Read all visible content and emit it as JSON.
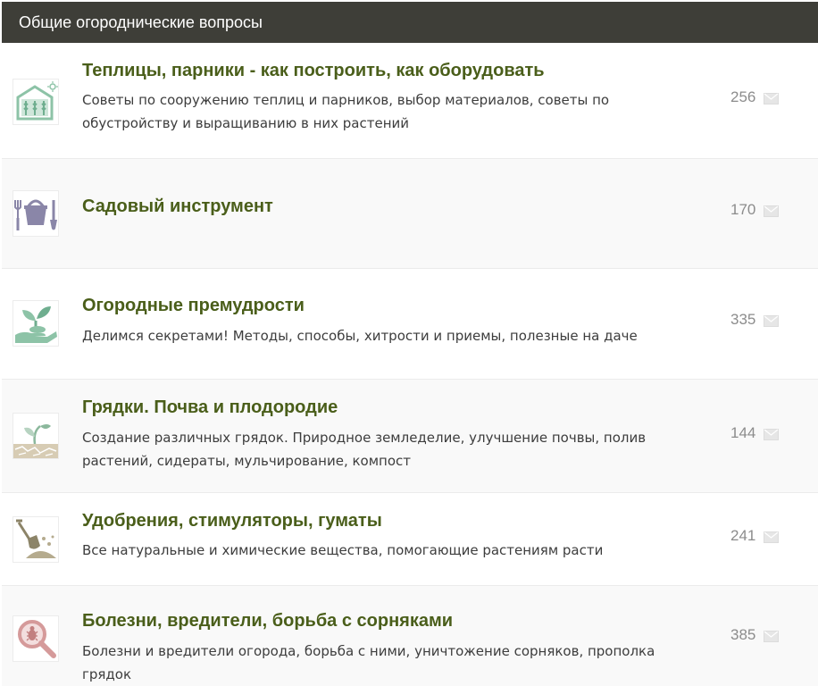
{
  "section_title": "Общие огороднические вопросы",
  "forums": [
    {
      "title": "Теплицы, парники - как построить, как оборудовать",
      "description": "Советы по сооружению теплиц и парников, выбор материалов, советы по обустройству и выращиванию в них растений",
      "count": "256",
      "icon": "greenhouse-icon"
    },
    {
      "title": "Садовый инструмент",
      "description": "",
      "count": "170",
      "icon": "garden-tools-icon"
    },
    {
      "title": "Огородные премудрости",
      "description": "Делимся секретами! Методы, способы, хитрости и приемы, полезные на даче",
      "count": "335",
      "icon": "sprout-hand-icon"
    },
    {
      "title": "Грядки. Почва и плодородие",
      "description": "Создание различных грядок. Природное земледелие, улучшение почвы,  полив растений, сидераты, мульчирование, компост",
      "count": "144",
      "icon": "soil-sprout-icon"
    },
    {
      "title": "Удобрения, стимуляторы, гуматы",
      "description": "Все натуральные и химические вещества, помогающие растениям расти",
      "count": "241",
      "icon": "shovel-fertilizer-icon"
    },
    {
      "title": "Болезни, вредители, борьба с сорняками",
      "description": "Болезни и вредители огорода, борьба с ними, уничтожение сорняков, прополка грядок",
      "count": "385",
      "icon": "pest-magnifier-icon"
    }
  ],
  "colors": {
    "header_bg": "#3e3e38",
    "title": "#4a5e1a",
    "icon_green": "#8dc3a7",
    "icon_purple": "#8a86a8",
    "icon_brown": "#a49a80",
    "icon_pink": "#d59a9a"
  }
}
